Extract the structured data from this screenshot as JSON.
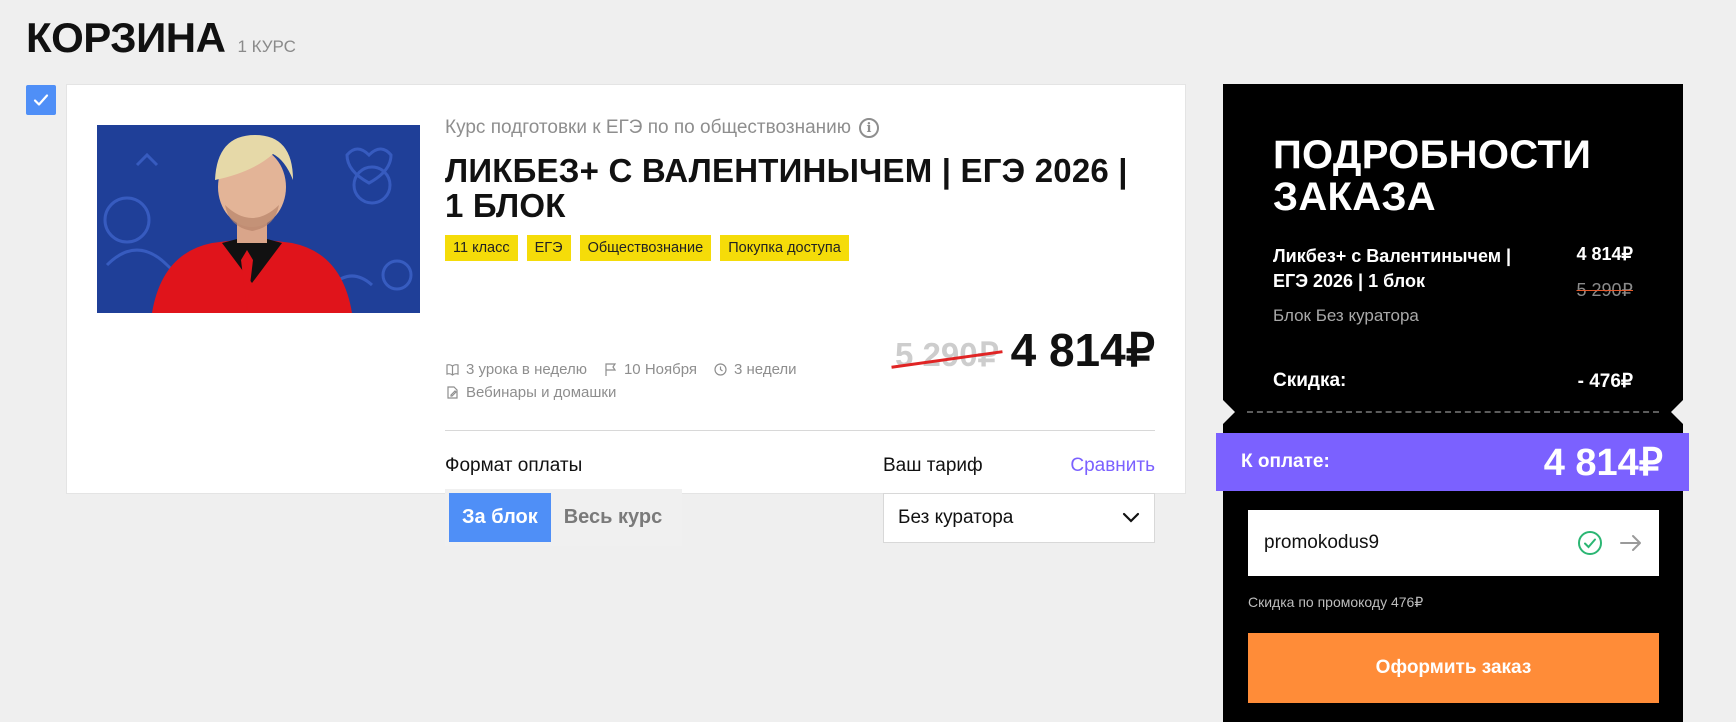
{
  "header": {
    "title": "КОРЗИНА",
    "count": "1 КУРС"
  },
  "course": {
    "subject": "Курс подготовки к ЕГЭ по по обществознанию",
    "title": "ЛИКБЕЗ+ С ВАЛЕНТИНЫЧЕМ | ЕГЭ 2026 | 1 БЛОК",
    "tags": [
      "11 класс",
      "ЕГЭ",
      "Обществознание",
      "Покупка доступа"
    ],
    "meta": {
      "lessons": "3 урока в неделю",
      "start": "10 Ноября",
      "duration": "3 недели",
      "format": "Вебинары и домашки"
    },
    "old_price": "5 290₽",
    "price": "4 814₽",
    "pay_format_label": "Формат оплаты",
    "pay_options": [
      "За блок",
      "Весь курс"
    ],
    "tariff_label": "Ваш тариф",
    "compare_label": "Сравнить",
    "tariff_value": "Без куратора"
  },
  "order": {
    "title": "ПОДРОБНОСТИ ЗАКАЗА",
    "item_name": "Ликбез+ с Валентинычем | ЕГЭ 2026 | 1 блок",
    "item_price": "4 814₽",
    "item_old_price": "5 290₽",
    "item_tariff": "Блок Без куратора",
    "discount_label": "Скидка:",
    "discount_value": "- 476₽",
    "pay_label": "К оплате:",
    "pay_amount": "4 814₽",
    "promo_code": "promokodus9",
    "promo_note": "Скидка по промокоду 476₽",
    "checkout_label": "Оформить заказ"
  },
  "colors": {
    "accent_blue": "#4f8ff7",
    "tag_yellow": "#f5dc09",
    "purple": "#7b61ff",
    "orange": "#ff8c38"
  }
}
